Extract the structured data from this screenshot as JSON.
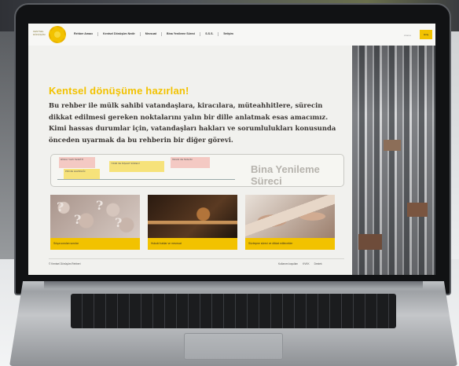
{
  "nav": {
    "logo_text": "KENTSEL DÖNÜŞÜM",
    "links": [
      "Rehber Amacı",
      "Kentsel Dönüşüm Nedir",
      "Mevzuat",
      "Bina Yenileme Süreci",
      "S.S.S.",
      "İletişim"
    ],
    "search_placeholder": "Arama",
    "button_label": "Giriş"
  },
  "hero": {
    "title": "Kentsel dönüşüme hazırlan!",
    "body": "Bu rehber ile mülk sahibi vatandaşlara, kiracılara, müteahhitlere, sürecin dikkat edilmesi gereken noktalarını yalın bir dille anlatmak esas amacımız. Kimi hassas durumlar için, vatandaşları hakları ve sorumlulukları konusunda önceden uyarmak da bu rehberin bir diğer görevi."
  },
  "process": {
    "title": "Bina Yenileme Süreci",
    "cards": [
      "RİSKLİ YAPI TESPİTİ",
      "PROJE HAZIRLIĞI",
      "YIKIM VE İNŞAAT SÜRECİ",
      "İSKAN VE TESLİM"
    ]
  },
  "cards": [
    {
      "caption": "Sıkça sorulan sorular",
      "icon": "question-marks-image"
    },
    {
      "caption": "Hukuki haklar ve mevzuat",
      "icon": "gavel-image"
    },
    {
      "caption": "Sözleşme süreci ve dikkat edilecekler",
      "icon": "signing-image"
    }
  ],
  "footer": {
    "left": "© Kentsel Dönüşüm Rehberi",
    "links": [
      "Kullanım koşulları",
      "KVKK",
      "Destek"
    ]
  },
  "colors": {
    "accent": "#f2c200",
    "text": "#3a3633"
  }
}
